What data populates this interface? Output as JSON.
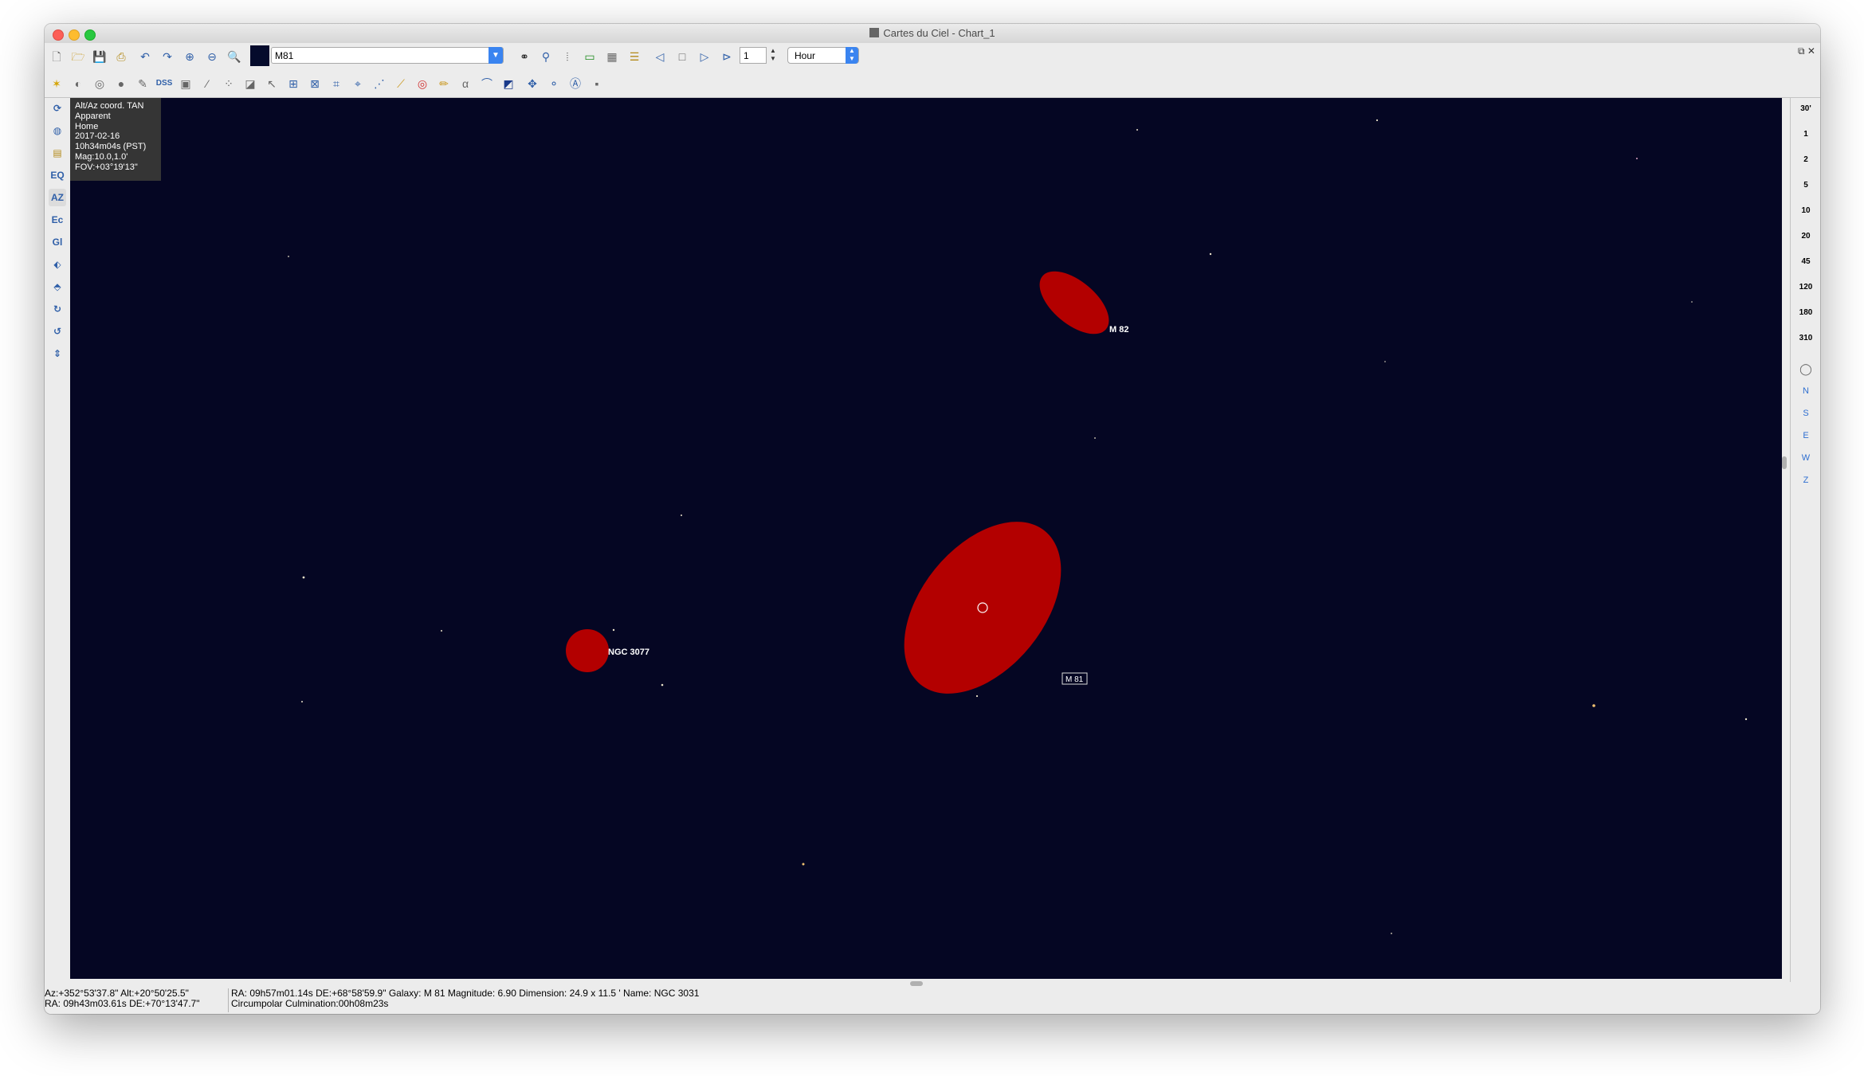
{
  "window": {
    "title": "Cartes du Ciel - Chart_1"
  },
  "toolbar": {
    "search_value": "M81",
    "step_value": "1",
    "time_unit": "Hour"
  },
  "toolbar2": {
    "dss_label": "DSS"
  },
  "left_toolbar": {
    "eq_label": "EQ",
    "az_label": "AZ",
    "ec_label": "Ec",
    "gl_label": "Gl"
  },
  "right_toolbar": {
    "fov_buttons": [
      "30'",
      "1",
      "2",
      "5",
      "10",
      "20",
      "45",
      "120",
      "180",
      "310"
    ],
    "directions": [
      "N",
      "S",
      "E",
      "W",
      "Z"
    ]
  },
  "chart_info": {
    "lines": [
      "Alt/Az coord. TAN",
      "Apparent",
      "Home",
      "2017-02-16",
      "10h34m04s (PST)",
      "Mag:10.0,1.0'",
      "FOV:+03°19'13\""
    ]
  },
  "objects": {
    "m82_label": "M 82",
    "ngc3077_label": "NGC 3077",
    "m81_label": "M 81"
  },
  "status": {
    "left_line1": "Az:+352°53'37.8\" Alt:+20°50'25.5\"",
    "left_line2": "RA: 09h43m03.61s DE:+70°13'47.7\"",
    "right_line1": "RA: 09h57m01.14s DE:+68°58'59.9\"  Galaxy: M 81   Magnitude:  6.90  Dimension:  24.9 x 11.5 '  Name: NGC 3031",
    "right_line2": "Circumpolar   Culmination:00h08m23s"
  },
  "colors": {
    "sky": "#050623",
    "galaxy": "#b30000"
  }
}
